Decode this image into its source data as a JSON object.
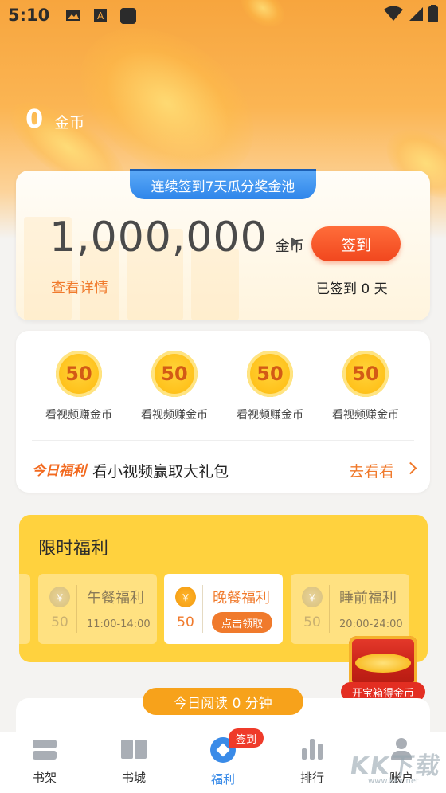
{
  "status_bar": {
    "time": "5:10"
  },
  "balance": {
    "coins": "0",
    "unit": "金币"
  },
  "signin_card": {
    "pool_tab": "连续签到7天瓜分奖金池",
    "jackpot": "1,000,000",
    "jackpot_unit": "金币",
    "signin_button": "签到",
    "details_link": "查看详情",
    "signed_days": "已签到 0 天"
  },
  "video_rewards": {
    "items": [
      {
        "coins": "50",
        "label": "看视频赚金币"
      },
      {
        "coins": "50",
        "label": "看视频赚金币"
      },
      {
        "coins": "50",
        "label": "看视频赚金币"
      },
      {
        "coins": "50",
        "label": "看视频赚金币"
      }
    ],
    "today_tag": "今日福利",
    "today_text": "看小视频赢取大礼包",
    "go_link": "去看看"
  },
  "limited": {
    "title": "限时福利",
    "meals": [
      {
        "name": "午餐福利",
        "coins": "50",
        "time": "11:00-14:00",
        "coin_symbol": "￥"
      },
      {
        "name": "晚餐福利",
        "coins": "50",
        "button": "点击领取",
        "coin_symbol": "￥"
      },
      {
        "name": "睡前福利",
        "coins": "50",
        "time": "20:00-24:00",
        "coin_symbol": "￥"
      }
    ]
  },
  "treasure": {
    "label": "开宝箱得金币"
  },
  "reading": {
    "today": "今日阅读 0 分钟"
  },
  "tabbar": {
    "tabs": [
      {
        "label": "书架",
        "icon": "bookshelf-icon"
      },
      {
        "label": "书城",
        "icon": "book-icon"
      },
      {
        "label": "福利",
        "icon": "welfare-icon",
        "active": true
      },
      {
        "label": "排行",
        "icon": "rank-icon"
      },
      {
        "label": "账户",
        "icon": "user-icon"
      }
    ],
    "signin_badge": "签到"
  },
  "watermark": {
    "text": "KK下载",
    "sub": "www.kkx.net"
  },
  "colors": {
    "accent_orange": "#f07a2c",
    "signin_red": "#f1471e",
    "tab_active": "#3a8be8",
    "limited_yellow": "#ffd23e"
  }
}
